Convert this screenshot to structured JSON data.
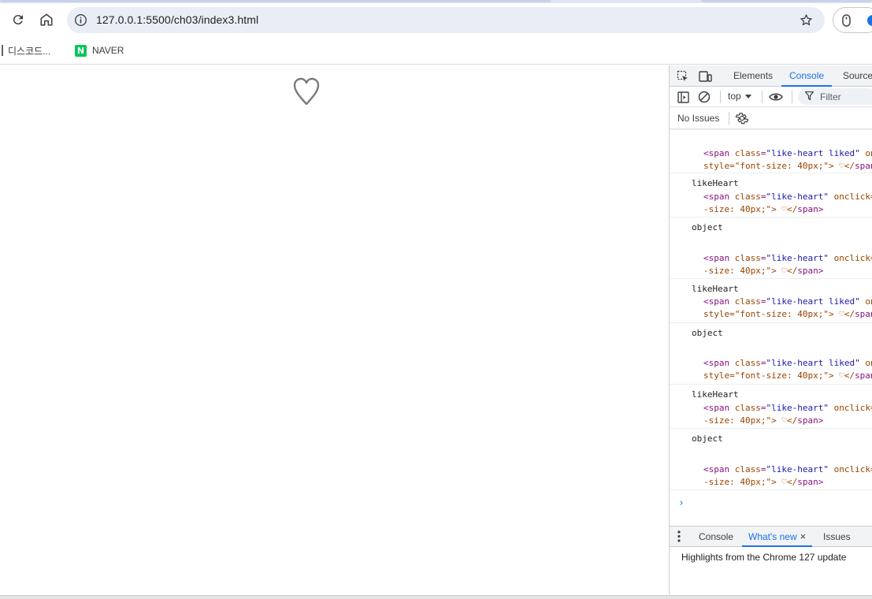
{
  "browser": {
    "url": "127.0.0.1:5500/ch03/index3.html",
    "bookmarks": [
      {
        "label": "디스코드..."
      },
      {
        "label": "NAVER",
        "logo_letter": "N"
      }
    ]
  },
  "page": {
    "heart": "♡"
  },
  "devtools": {
    "tabs": [
      "Elements",
      "Console",
      "Source"
    ],
    "active_tab": "Console",
    "context": "top",
    "filter_placeholder": "Filter",
    "issues_text": "No Issues",
    "console_entries": [
      {
        "label": "",
        "el_line1": {
          "cls": "like-heart liked",
          "tail": "oncli"
        },
        "el_line2": {
          "pre": "style=\"font-size: 40px;\"> ♡</",
          "close": "span>"
        }
      },
      {
        "label": "likeHeart",
        "el_line1": {
          "cls": "like-heart",
          "tail": "onclick=\"li"
        },
        "el_line2": {
          "pre": "-size: 40px;\"> ♡</",
          "close": "span>"
        }
      },
      {
        "label": "object",
        "el_line1": {
          "cls": "like-heart",
          "tail": "onclick=\"li"
        },
        "el_line2": {
          "pre": "-size: 40px;\"> ♡</",
          "close": "span>"
        }
      },
      {
        "label": "likeHeart",
        "el_line1": {
          "cls": "like-heart liked",
          "tail": "oncli"
        },
        "el_line2": {
          "pre": "style=\"font-size: 40px;\"> ♡</",
          "close": "span>"
        }
      },
      {
        "label": "object",
        "el_line1": {
          "cls": "like-heart liked",
          "tail": "oncli"
        },
        "el_line2": {
          "pre": "style=\"font-size: 40px;\"> ♡</",
          "close": "span>"
        }
      },
      {
        "label": "likeHeart",
        "el_line1": {
          "cls": "like-heart",
          "tail": "onclick=\"li"
        },
        "el_line2": {
          "pre": "-size: 40px;\"> ♡</",
          "close": "span>"
        }
      },
      {
        "label": "object",
        "el_line1": {
          "cls": "like-heart",
          "tail": "onclick=\"li"
        },
        "el_line2": {
          "pre": "-size: 40px;\"> ♡</",
          "close": "span>"
        }
      }
    ],
    "prompt": "›",
    "drawer_tabs": [
      "Console",
      "What's new",
      "Issues"
    ],
    "drawer_active": "What's new",
    "close_glyph": "×",
    "whats_new_text": "Highlights from the Chrome 127 update"
  }
}
